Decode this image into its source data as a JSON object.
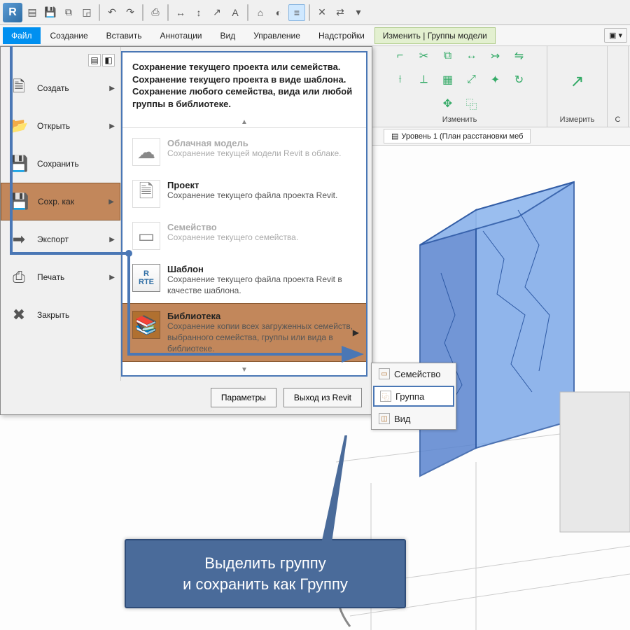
{
  "qat": {
    "logo": "R"
  },
  "menu": {
    "file": "Файл",
    "create": "Создание",
    "insert": "Вставить",
    "annot": "Аннотации",
    "view": "Вид",
    "manage": "Управление",
    "addins": "Надстройки",
    "modify": "Изменить | Группы модели"
  },
  "ribbon": {
    "panel_modify": "Изменить",
    "panel_measure": "Измерить",
    "panel_c": "С"
  },
  "viewtab": {
    "label": "Уровень 1 (План расстановки меб"
  },
  "fileMenu": {
    "left": {
      "create": "Создать",
      "open": "Открыть",
      "save": "Сохранить",
      "saveas": "Сохр. как",
      "export": "Экспорт",
      "print": "Печать",
      "close": "Закрыть"
    },
    "heading": "Сохранение текущего проекта или семейства. Сохранение текущего проекта в виде шаблона. Сохранение любого семейства, вида или любой группы в библиотеке.",
    "items": {
      "cloud": {
        "title": "Облачная модель",
        "desc": "Сохранение текущей модели Revit в облаке."
      },
      "project": {
        "title": "Проект",
        "desc": "Сохранение текущего файла проекта Revit."
      },
      "family": {
        "title": "Семейство",
        "desc": "Сохранение текущего семейства."
      },
      "template": {
        "title": "Шаблон",
        "desc": "Сохранение текущего файла проекта Revit в качестве шаблона.",
        "badge": "RTE"
      },
      "library": {
        "title": "Библиотека",
        "desc": "Сохранение копии всех загруженных семейств, выбранного семейства, группы или вида в библиотеке."
      }
    },
    "footer": {
      "options": "Параметры",
      "exit": "Выход из Revit"
    }
  },
  "subfly": {
    "family": "Семейство",
    "group": "Группа",
    "view": "Вид"
  },
  "callout": {
    "line1": "Выделить группу",
    "line2": "и сохранить как Группу"
  }
}
